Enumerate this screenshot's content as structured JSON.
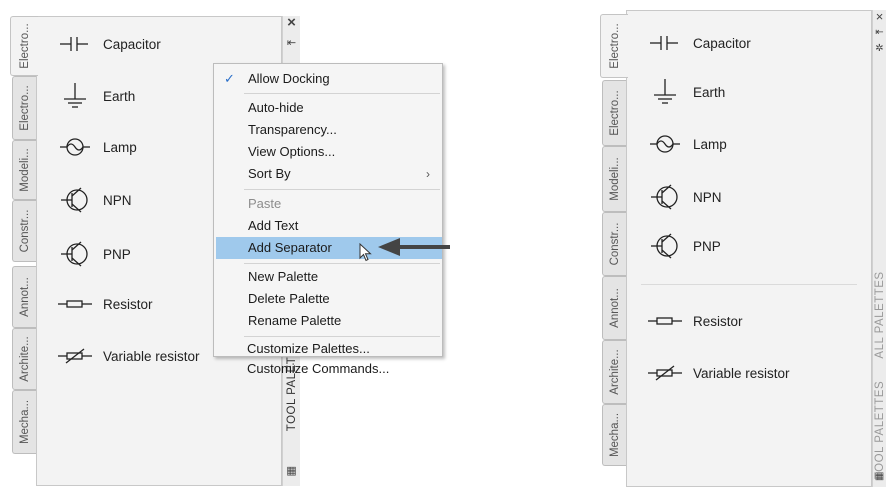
{
  "left_palette": {
    "tabs": [
      "Electro...",
      "Electro...",
      "Modeli...",
      "Constr...",
      "Annot...",
      "Archite...",
      "Mecha..."
    ],
    "tools": [
      {
        "label": "Capacitor",
        "icon": "capacitor-icon"
      },
      {
        "label": "Earth",
        "icon": "earth-ground-icon"
      },
      {
        "label": "Lamp",
        "icon": "lamp-icon"
      },
      {
        "label": "NPN",
        "icon": "npn-transistor-icon"
      },
      {
        "label": "PNP",
        "icon": "pnp-transistor-icon"
      },
      {
        "label": "Resistor",
        "icon": "resistor-icon"
      },
      {
        "label": "Variable resistor",
        "icon": "variable-resistor-icon"
      }
    ],
    "strip_title": "TOOL PALET"
  },
  "context_menu": {
    "items": [
      {
        "label": "Allow Docking",
        "checked": true
      },
      {
        "label": "Auto-hide"
      },
      {
        "label": "Transparency..."
      },
      {
        "label": "View Options..."
      },
      {
        "label": "Sort By",
        "submenu": true
      },
      {
        "label": "Paste",
        "disabled": true
      },
      {
        "label": "Add Text"
      },
      {
        "label": "Add Separator",
        "highlighted": true
      },
      {
        "label": "New Palette"
      },
      {
        "label": "Delete Palette"
      },
      {
        "label": "Rename Palette"
      },
      {
        "label": "Customize Palettes..."
      },
      {
        "label": "Customize Commands..."
      }
    ],
    "check_glyph": "✓",
    "submenu_glyph": "›"
  },
  "right_palette": {
    "tabs": [
      "Electro...",
      "Electro...",
      "Modeli...",
      "Constr...",
      "Annot...",
      "Archite...",
      "Mecha..."
    ],
    "tools": [
      {
        "label": "Capacitor",
        "icon": "capacitor-icon"
      },
      {
        "label": "Earth",
        "icon": "earth-ground-icon"
      },
      {
        "label": "Lamp",
        "icon": "lamp-icon"
      },
      {
        "label": "NPN",
        "icon": "npn-transistor-icon"
      },
      {
        "label": "PNP",
        "icon": "pnp-transistor-icon"
      },
      {
        "label": "Resistor",
        "icon": "resistor-icon"
      },
      {
        "label": "Variable resistor",
        "icon": "variable-resistor-icon"
      }
    ],
    "strip_title_1": "TOOL PALETTES",
    "strip_title_2": "ALL PALETTES"
  },
  "colors": {
    "menu_highlight": "#9fc9ec",
    "check": "#2a6fc9",
    "arrow": "#444444"
  }
}
